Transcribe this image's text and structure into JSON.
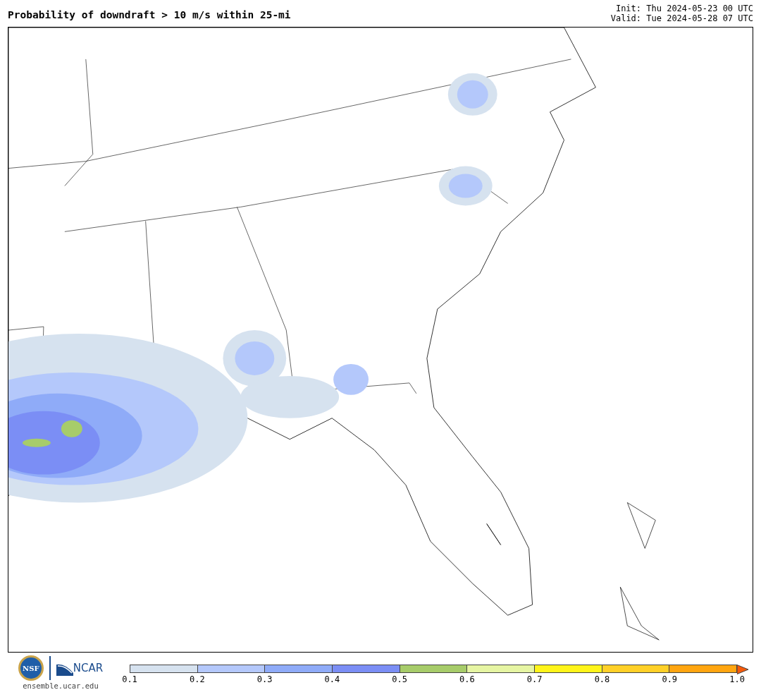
{
  "title": "Probability of downdraft > 10 m/s within 25-mi",
  "init": "Init: Thu 2024-05-23 00 UTC",
  "valid": "Valid: Tue 2024-05-28 07 UTC",
  "footer": {
    "nsf_logo": "NSF",
    "ncar_logo": "NCAR",
    "site": "ensemble.ucar.edu"
  },
  "colorbar": {
    "bins": [
      {
        "color": "#d6e2ef"
      },
      {
        "color": "#b4c8fb"
      },
      {
        "color": "#8fabf8"
      },
      {
        "color": "#7b8ef5"
      },
      {
        "color": "#a7cc6a"
      },
      {
        "color": "#e6f5a3"
      },
      {
        "color": "#fff41a"
      },
      {
        "color": "#ffd028"
      },
      {
        "color": "#ffa510"
      }
    ],
    "extend_arrow": {
      "color": "#f55a0a"
    },
    "ticks": [
      "0.1",
      "0.2",
      "0.3",
      "0.4",
      "0.5",
      "0.6",
      "0.7",
      "0.8",
      "0.9",
      "1.0"
    ]
  }
}
